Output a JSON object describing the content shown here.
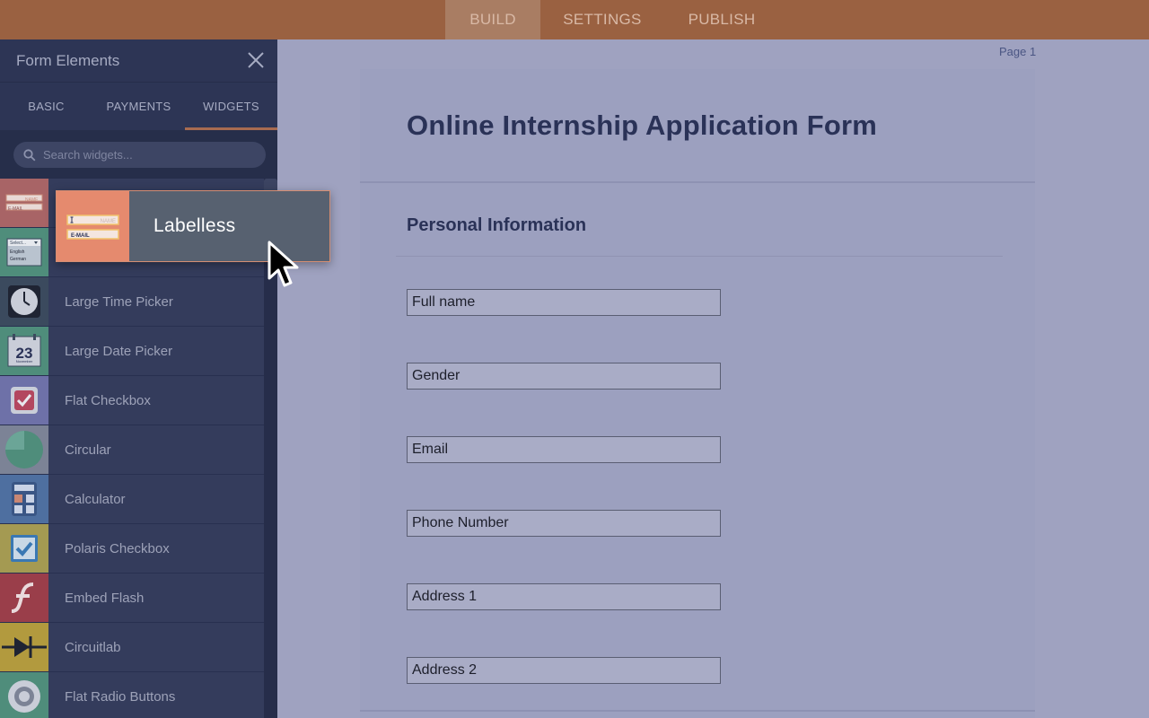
{
  "topnav": {
    "tabs": [
      {
        "label": "BUILD",
        "active": true
      },
      {
        "label": "SETTINGS",
        "active": false
      },
      {
        "label": "PUBLISH",
        "active": false
      }
    ]
  },
  "panel": {
    "title": "Form Elements",
    "tabs": [
      {
        "label": "BASIC",
        "active": false
      },
      {
        "label": "PAYMENTS",
        "active": false
      },
      {
        "label": "WIDGETS",
        "active": true
      }
    ],
    "search_placeholder": "Search widgets...",
    "widgets": [
      {
        "label": "",
        "icon": "labelless-icon"
      },
      {
        "label": "",
        "icon": "dropdown-language-icon"
      },
      {
        "label": "Large Time Picker",
        "icon": "clock-icon"
      },
      {
        "label": "Large Date Picker",
        "icon": "calendar-icon"
      },
      {
        "label": "Flat Checkbox",
        "icon": "flat-checkbox-icon"
      },
      {
        "label": "Circular",
        "icon": "circle-icon"
      },
      {
        "label": "Calculator",
        "icon": "calculator-icon"
      },
      {
        "label": "Polaris Checkbox",
        "icon": "polaris-checkbox-icon"
      },
      {
        "label": "Embed Flash",
        "icon": "flash-icon"
      },
      {
        "label": "Circuitlab",
        "icon": "diode-icon"
      },
      {
        "label": "Flat Radio Buttons",
        "icon": "radio-icon"
      }
    ],
    "icon_text": {
      "name": "NAME",
      "email": "E-MAIL",
      "select": "Select...",
      "english": "English",
      "german": "German",
      "day": "23",
      "month": "November"
    }
  },
  "drag_card": {
    "label": "Labelless",
    "icon": "labelless-icon"
  },
  "form": {
    "page_label": "Page 1",
    "title": "Online Internship Application Form",
    "section_title": "Personal Information",
    "fields": [
      "Full name",
      "Gender",
      "Email",
      "Phone Number",
      "Address 1",
      "Address 2"
    ]
  },
  "colors": {
    "topbar": "#9a6141",
    "panel": "#2d3555",
    "accent": "#a86b50",
    "drag_icon": "#e58a6e",
    "form_bg": "#9ca0bf",
    "title_text": "#2a3257"
  }
}
